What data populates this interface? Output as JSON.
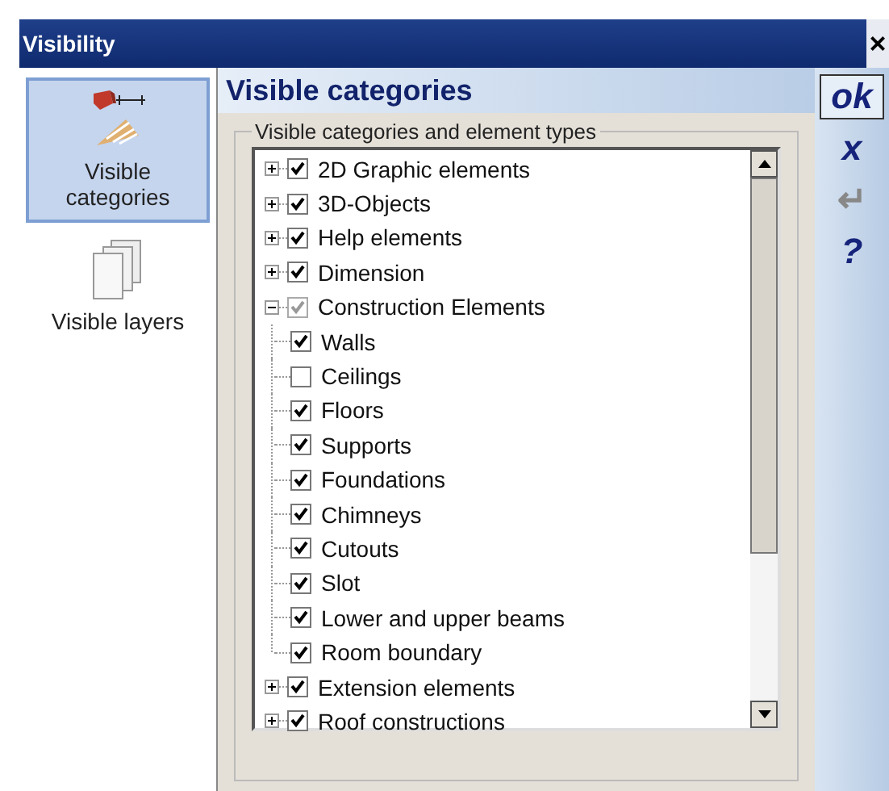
{
  "window": {
    "title": "Visibility",
    "close": "×"
  },
  "sidebar": {
    "items": [
      {
        "label": "Visible categories",
        "kind": "categories",
        "selected": true
      },
      {
        "label": "Visible layers",
        "kind": "layers",
        "selected": false
      }
    ]
  },
  "heading": "Visible categories",
  "group": {
    "title": "Visible categories and element types",
    "tree": [
      {
        "label": "2D Graphic elements",
        "checked": true,
        "greyed": false,
        "expanded": false
      },
      {
        "label": "3D-Objects",
        "checked": true,
        "greyed": false,
        "expanded": false
      },
      {
        "label": "Help elements",
        "checked": true,
        "greyed": false,
        "expanded": false
      },
      {
        "label": "Dimension",
        "checked": true,
        "greyed": false,
        "expanded": false
      },
      {
        "label": "Construction Elements",
        "checked": true,
        "greyed": true,
        "expanded": true,
        "children": [
          {
            "label": "Walls",
            "checked": true
          },
          {
            "label": "Ceilings",
            "checked": false
          },
          {
            "label": "Floors",
            "checked": true
          },
          {
            "label": "Supports",
            "checked": true
          },
          {
            "label": "Foundations",
            "checked": true
          },
          {
            "label": "Chimneys",
            "checked": true
          },
          {
            "label": "Cutouts",
            "checked": true
          },
          {
            "label": "Slot",
            "checked": true
          },
          {
            "label": "Lower and upper beams",
            "checked": true
          },
          {
            "label": "Room boundary",
            "checked": true
          }
        ]
      },
      {
        "label": "Extension elements",
        "checked": true,
        "greyed": false,
        "expanded": false
      },
      {
        "label": "Roof constructions",
        "checked": true,
        "greyed": false,
        "expanded": false
      }
    ]
  },
  "actions": [
    {
      "label": "ok",
      "selected": true,
      "disabled": false
    },
    {
      "label": "x",
      "selected": false,
      "disabled": false
    },
    {
      "label": "↵",
      "selected": false,
      "disabled": true
    },
    {
      "label": "?",
      "selected": false,
      "disabled": false
    }
  ]
}
